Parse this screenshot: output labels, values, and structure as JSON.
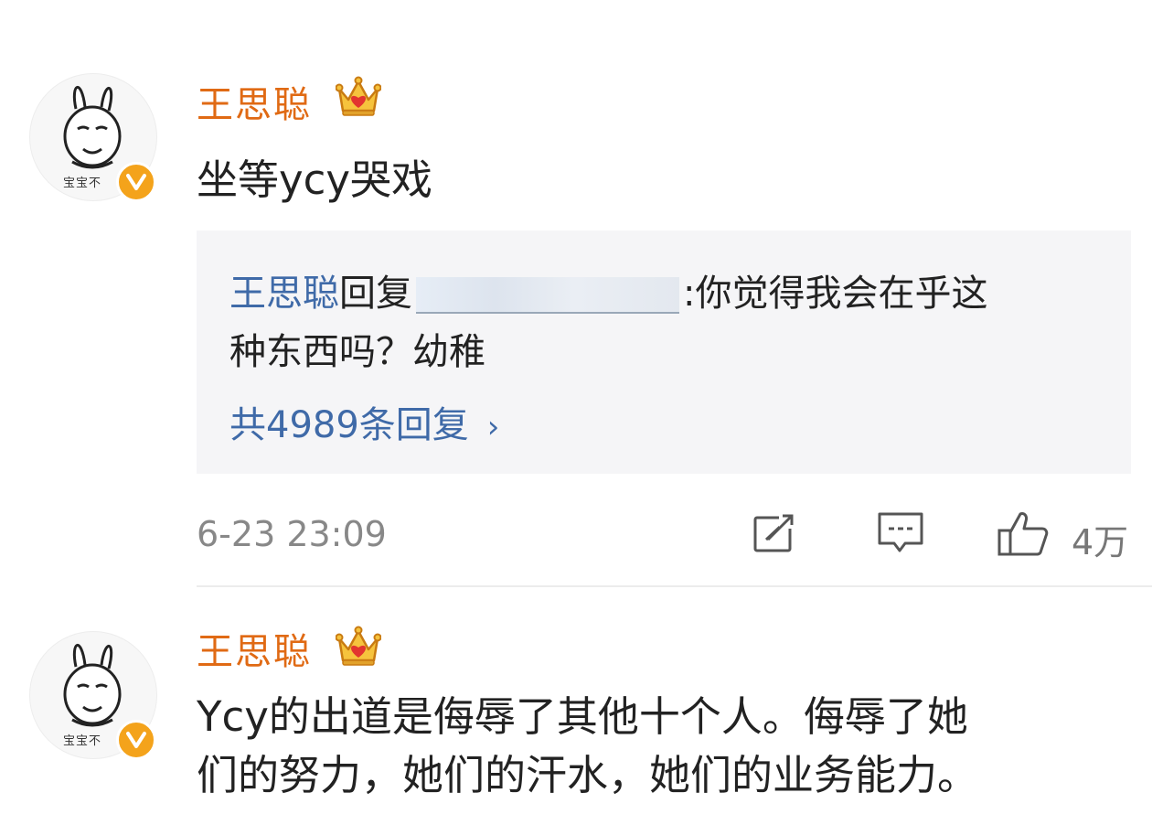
{
  "posts": [
    {
      "username": "王思聪",
      "avatar_caption": "宝宝不",
      "text_lines": [
        "坐等ycy哭戏"
      ],
      "reply": {
        "author": "王思聪",
        "reply_word": "回复",
        "text_after": ":你觉得我会在乎这",
        "text_line2": "种东西吗？幼稚",
        "count_label": "共4989条回复",
        "chevron": "›"
      },
      "timestamp": "6-23 23:09",
      "like_count": "4万"
    },
    {
      "username": "王思聪",
      "avatar_caption": "宝宝不",
      "text_lines": [
        "Ycy的出道是侮辱了其他十个人。侮辱了她",
        "们的努力，她们的汗水，她们的业务能力。"
      ]
    }
  ],
  "icons": {
    "verified": "verified-v-badge-icon",
    "vip": "crown-vip-icon",
    "share": "share-icon",
    "comment": "comment-icon",
    "like": "thumbs-up-icon"
  },
  "colors": {
    "username": "#e06a14",
    "reply_link": "#3f6aa8",
    "badge": "#f4a31b"
  }
}
